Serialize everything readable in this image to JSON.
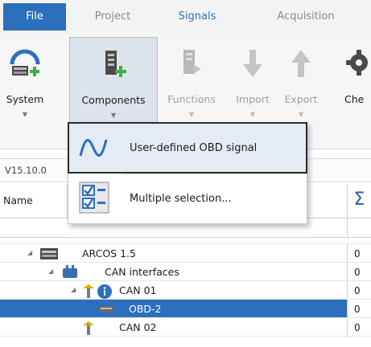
{
  "menubar": {
    "tabs": [
      {
        "label": "File"
      },
      {
        "label": "Project"
      },
      {
        "label": "Signals"
      },
      {
        "label": "Acquisition"
      }
    ]
  },
  "ribbon": {
    "buttons": [
      {
        "label": "System",
        "icon": "system-icon",
        "enabled": true
      },
      {
        "label": "Components",
        "icon": "components-icon",
        "enabled": true
      },
      {
        "label": "Functions",
        "icon": "functions-icon",
        "enabled": false
      },
      {
        "label": "Import",
        "icon": "import-arrow-icon",
        "enabled": false
      },
      {
        "label": "Export",
        "icon": "export-arrow-icon",
        "enabled": false
      },
      {
        "label": "Che",
        "icon": "gear-icon",
        "enabled": true
      }
    ]
  },
  "version_text": "V15.10.0",
  "table": {
    "name_header": "Name",
    "sum_header": "Σ"
  },
  "dropdown": {
    "items": [
      {
        "label": "User-defined OBD signal",
        "icon": "signal-wave-icon"
      },
      {
        "label": "Multiple selection...",
        "icon": "multi-select-checklist-icon"
      }
    ]
  },
  "tree": {
    "rows": [
      {
        "label": "ARCOS 1.5",
        "value": "0",
        "icon": "device-icon"
      },
      {
        "label": "CAN interfaces",
        "value": "0",
        "icon": "can-icon"
      },
      {
        "label": "CAN 01",
        "value": "0",
        "icon": "can-port-info-icon"
      },
      {
        "label": "OBD-2",
        "value": "0",
        "icon": "obd-icon"
      },
      {
        "label": "CAN 02",
        "value": "0",
        "icon": "can-port-icon"
      }
    ]
  },
  "colors": {
    "accent": "#2c6fbd",
    "signals_tab": "#2f73b8",
    "add_green": "#3fae3f"
  }
}
